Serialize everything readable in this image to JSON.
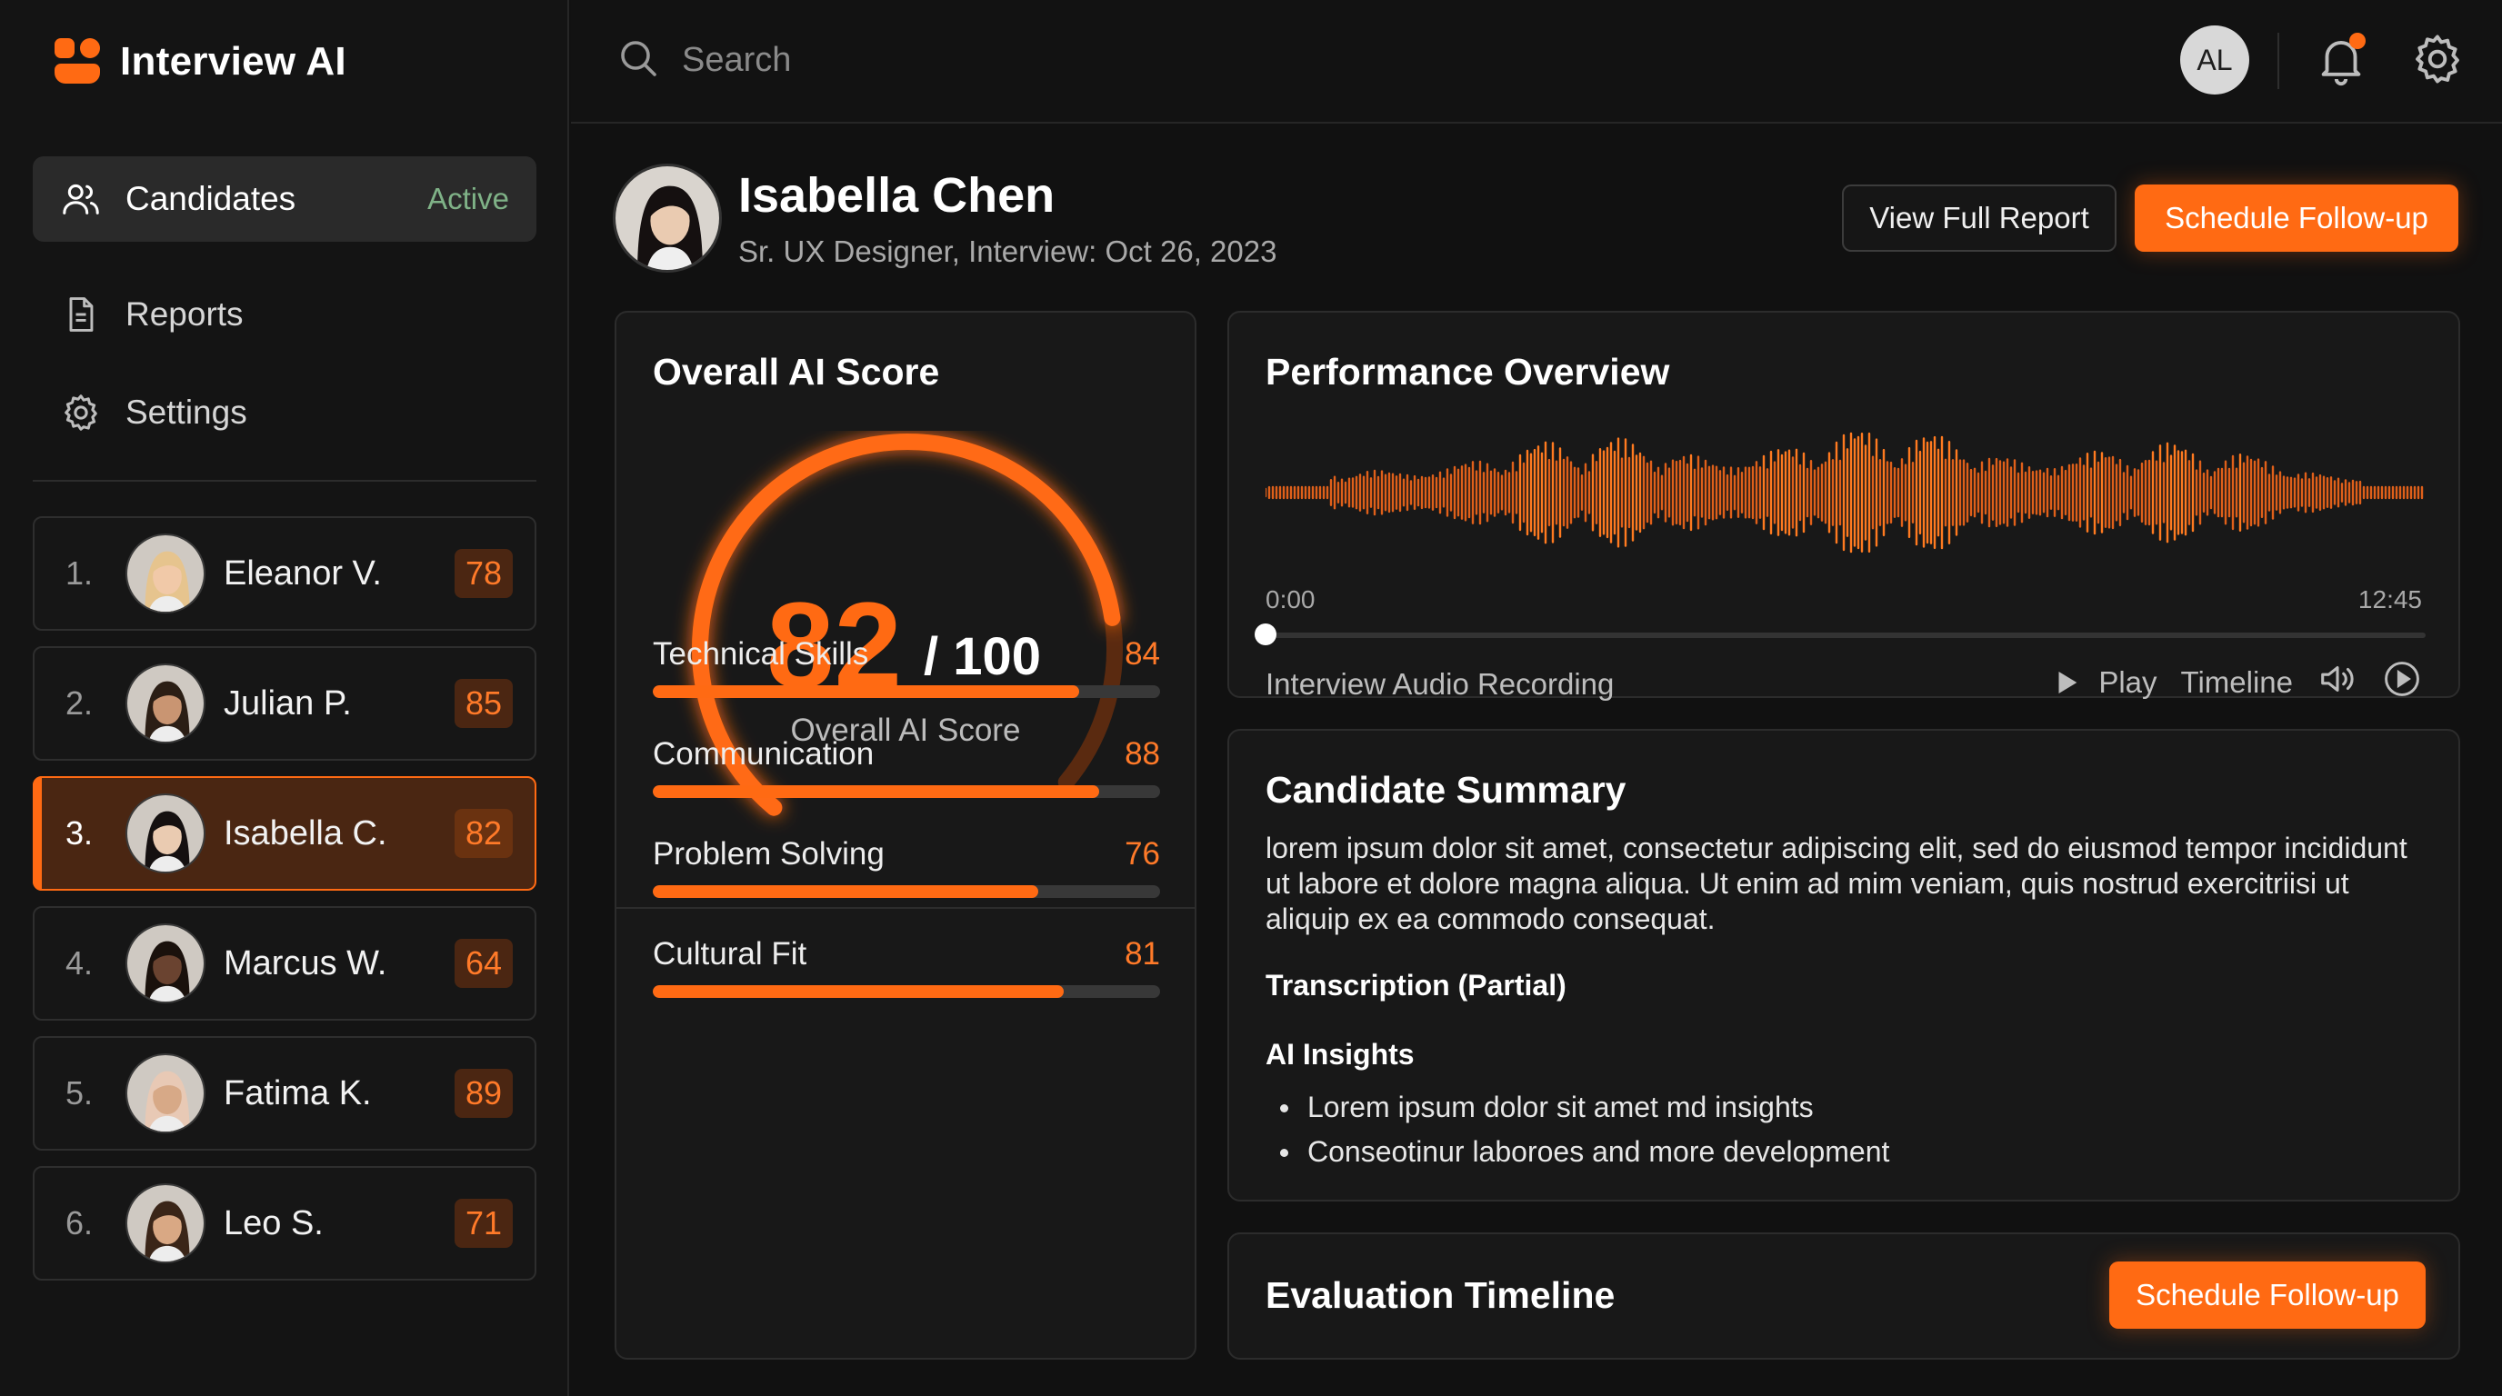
{
  "app": {
    "name": "Interview AI"
  },
  "nav": {
    "candidates": {
      "label": "Candidates",
      "badge": "Active"
    },
    "reports": {
      "label": "Reports"
    },
    "settings": {
      "label": "Settings"
    }
  },
  "candidates": [
    {
      "rank": "1.",
      "name": "Eleanor V.",
      "score": "78",
      "skin": "#F1C9A8",
      "hair": "#E6C48E"
    },
    {
      "rank": "2.",
      "name": "Julian P.",
      "score": "85",
      "skin": "#C99572",
      "hair": "#2B1E15"
    },
    {
      "rank": "3.",
      "name": "Isabella C.",
      "score": "82",
      "skin": "#EACBB1",
      "hair": "#151010"
    },
    {
      "rank": "4.",
      "name": "Marcus W.",
      "score": "64",
      "skin": "#6A4330",
      "hair": "#1A110C"
    },
    {
      "rank": "5.",
      "name": "Fatima K.",
      "score": "89",
      "skin": "#D7A987",
      "hair": "#E8C9B5"
    },
    {
      "rank": "6.",
      "name": "Leo S.",
      "score": "71",
      "skin": "#D9A884",
      "hair": "#3A2518"
    }
  ],
  "topbar": {
    "search_placeholder": "Search",
    "user_initials": "AL"
  },
  "profile": {
    "name": "Isabella Chen",
    "subtitle": "Sr. UX Designer, Interview: Oct 26, 2023",
    "view_report_label": "View Full Report",
    "schedule_label": "Schedule Follow-up"
  },
  "score_card": {
    "title": "Overall AI Score",
    "score": "82",
    "denominator": "/ 100",
    "label": "Overall AI Score",
    "score_fraction": 0.82,
    "metrics": [
      {
        "label": "Technical Skills",
        "value": "84",
        "fraction": 0.84
      },
      {
        "label": "Communication",
        "value": "88",
        "fraction": 0.88
      },
      {
        "label": "Problem Solving",
        "value": "76",
        "fraction": 0.76
      },
      {
        "label": "Cultural Fit",
        "value": "81",
        "fraction": 0.81
      }
    ]
  },
  "performance": {
    "title": "Performance Overview",
    "time_start": "0:00",
    "time_end": "12:45",
    "playback_fraction": 0,
    "audio_label": "Interview Audio Recording",
    "play_label": "Play",
    "timeline_label": "Timeline"
  },
  "summary": {
    "title": "Candidate Summary",
    "text": "lorem ipsum dolor sit amet, consectetur adipiscing elit, sed do eiusmod tempor incididunt ut labore et dolore magna aliqua. Ut enim ad mim veniam, quis nostrud exercitriisi ut aliquip ex ea commodo consequat.",
    "transcription_heading": "Transcription (Partial)",
    "insights_heading": "AI Insights",
    "insights": [
      "Lorem ipsum dolor sit amet md insights",
      "Conseotinur laboroes and more development"
    ]
  },
  "timeline": {
    "title": "Evaluation Timeline",
    "schedule_label": "Schedule Follow-up"
  },
  "colors": {
    "accent": "#FF6A13",
    "background": "#111111",
    "card": "#181818",
    "active_badge": "#7FB287"
  }
}
